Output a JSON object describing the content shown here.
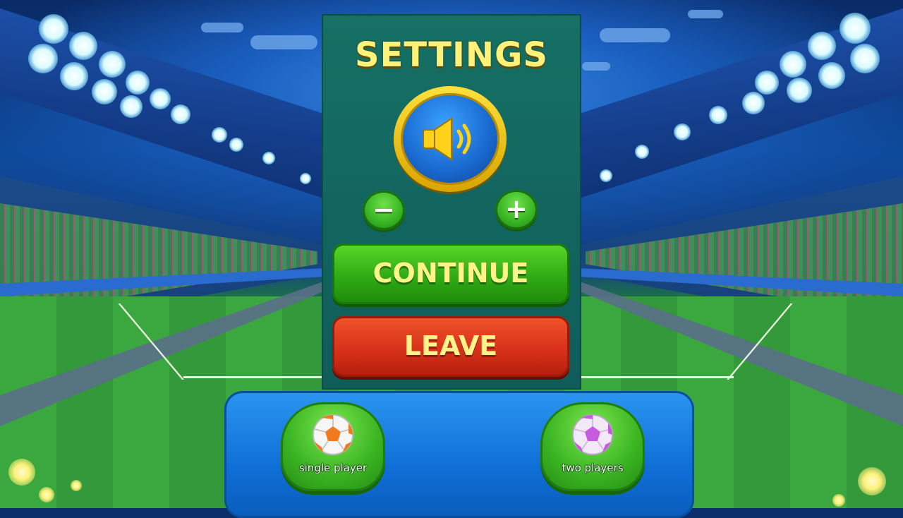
{
  "settings": {
    "title": "SETTINGS",
    "volume": {
      "icon": "speaker-icon",
      "minus_label": "−",
      "plus_label": "+"
    },
    "continue_label": "CONTINUE",
    "leave_label": "LEAVE"
  },
  "modes": {
    "single": {
      "label": "single player",
      "icon": "soccer-ball-orange-icon"
    },
    "two": {
      "label": "two players",
      "icon": "soccer-ball-purple-icon"
    }
  },
  "colors": {
    "title": "#fff27a",
    "continue": "#2fab14",
    "leave": "#d8321a",
    "panel": "#167064",
    "tray": "#1a82e4"
  }
}
